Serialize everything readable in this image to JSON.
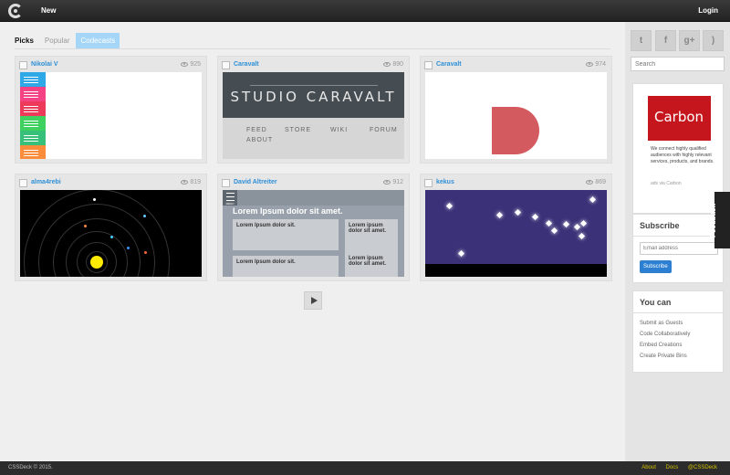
{
  "topbar": {
    "new_label": "New",
    "login_label": "Login"
  },
  "tabs": [
    {
      "label": "Picks"
    },
    {
      "label": "Popular"
    },
    {
      "label": "Codecasts"
    }
  ],
  "cards": [
    {
      "author": "Nikolai V",
      "views": "925"
    },
    {
      "author": "Caravalt",
      "views": "890",
      "title": "STUDIO CARAVALT",
      "nav": [
        "FEED",
        "STORE",
        "WIKI",
        "FORUM",
        "ABOUT"
      ]
    },
    {
      "author": "Caravalt",
      "views": "974"
    },
    {
      "author": "alma4rebi",
      "views": "819"
    },
    {
      "author": "David Altreiter",
      "views": "912",
      "heading": "Lorem Ipsum dolor sit amet.",
      "menu": "MENU",
      "box1_title": "Lorem Ipsum dolor sit.",
      "box2_title": "Lorem ipsum dolor sit amet.",
      "box3_title": "Lorem Ipsum dolor sit.",
      "box4_title": "Lorem ipsum dolor sit amet."
    },
    {
      "author": "kekus",
      "views": "869"
    }
  ],
  "sidebar": {
    "social": [
      "twitter-icon",
      "facebook-icon",
      "googleplus-icon",
      "rss-icon"
    ],
    "search_placeholder": "Search",
    "ad": {
      "brand": "Carbon",
      "text": "We connect highly qualified audiences with highly relevant services, products, and brands.",
      "via": "ads via Carbon"
    },
    "subscribe": {
      "title": "Subscribe",
      "placeholder": "Email address",
      "button": "Subscribe"
    },
    "youcan": {
      "title": "You can",
      "items": [
        "Submit as Guests",
        "Code Collaboratively",
        "Embed Creations",
        "Create Private Bins"
      ]
    }
  },
  "feedback_label": "Feedback",
  "footer": {
    "copyright": "CSSDeck © 2015.",
    "links": [
      "About",
      "Docs",
      "@CSSDeck"
    ]
  },
  "colors": {
    "link": "#2e8fd6",
    "codecasts_tab": "#a6d6f7",
    "footer_link": "#d4c100"
  }
}
